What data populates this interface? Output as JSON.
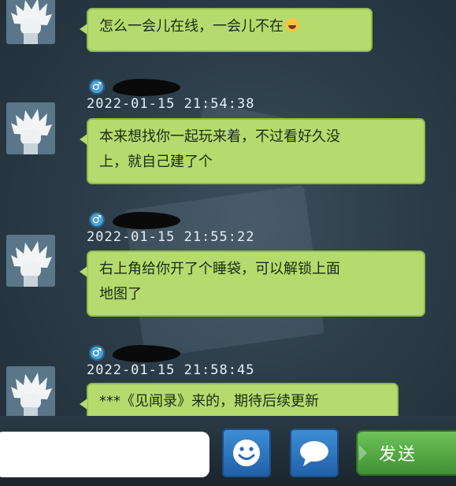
{
  "messages": [
    {
      "gender_symbol": "♂",
      "timestamp": "",
      "lines": [
        "怎么一会儿在线，一会儿不在"
      ],
      "emoji": "laughing-crying-emoji"
    },
    {
      "gender_symbol": "♂",
      "timestamp": "2022-01-15  21:54:38",
      "lines": [
        "本来想找你一起玩来着，不过看好久没",
        "上，就自己建了个"
      ]
    },
    {
      "gender_symbol": "♂",
      "timestamp": "2022-01-15  21:55:22",
      "lines": [
        "右上角给你开了个睡袋，可以解锁上面",
        "地图了"
      ]
    },
    {
      "gender_symbol": "♂",
      "timestamp": "2022-01-15  21:58:45",
      "lines": [
        "***《见闻录》来的，期待后续更新"
      ]
    }
  ],
  "input": {
    "value": "",
    "placeholder": ""
  },
  "buttons": {
    "emoji_icon": "smiley-icon",
    "chat_icon": "speech-bubble-icon",
    "send_label": "发送"
  },
  "colors": {
    "bubble": "#b5db6e",
    "gender_badge": "#4aa2da",
    "send_button": "#52a844",
    "icon_button": "#2f78c2"
  }
}
